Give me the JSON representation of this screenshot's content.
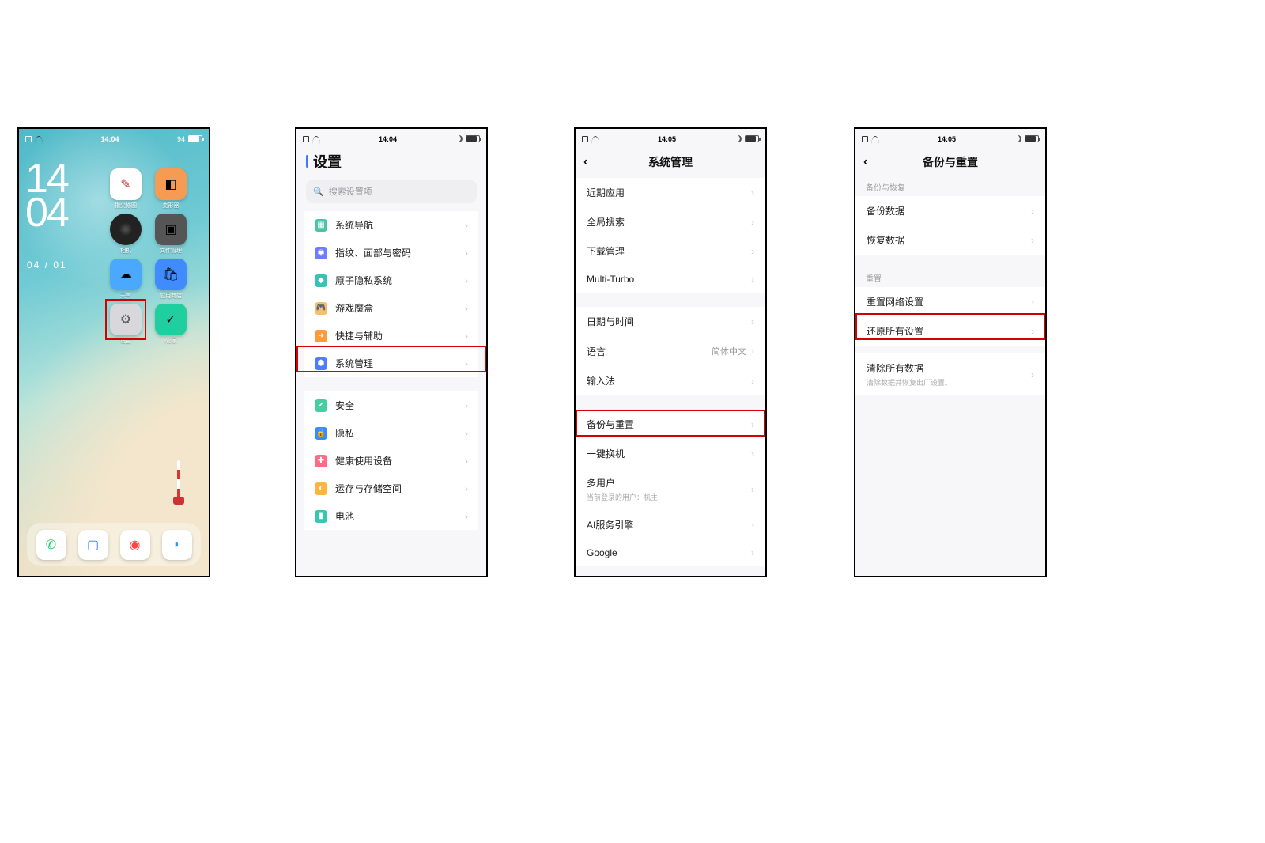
{
  "phone1": {
    "status": {
      "time": "14:04",
      "battery": "94"
    },
    "clock": {
      "hh": "14",
      "mm": "04"
    },
    "date": "04 / 01",
    "apps": {
      "a11": "指尖修图",
      "a12": "变形器",
      "a21": "相机",
      "a22": "文件管理",
      "a31": "天气",
      "a32": "应用商店",
      "a41": "设置",
      "a42": "i管家"
    }
  },
  "phone2": {
    "status": {
      "time": "14:04",
      "battery": "94"
    },
    "title": "设置",
    "search_placeholder": "搜索设置项",
    "items1": [
      "系统导航",
      "指纹、面部与密码",
      "原子隐私系统",
      "游戏魔盒",
      "快捷与辅助",
      "系统管理"
    ],
    "items2": [
      "安全",
      "隐私",
      "健康使用设备",
      "运存与存储空间",
      "电池"
    ]
  },
  "phone3": {
    "status": {
      "time": "14:05",
      "battery": "94"
    },
    "title": "系统管理",
    "grp1": [
      "近期应用",
      "全局搜索",
      "下载管理",
      "Multi-Turbo"
    ],
    "grp2": [
      {
        "label": "日期与时间"
      },
      {
        "label": "语言",
        "value": "简体中文"
      },
      {
        "label": "输入法"
      }
    ],
    "grp3": [
      {
        "label": "备份与重置"
      },
      {
        "label": "一键换机"
      },
      {
        "label": "多用户",
        "sub": "当前登录的用户：机主"
      },
      {
        "label": "AI服务引擎"
      },
      {
        "label": "Google"
      }
    ]
  },
  "phone4": {
    "status": {
      "time": "14:05",
      "battery": "94"
    },
    "title": "备份与重置",
    "sec1_hdr": "备份与恢复",
    "sec1": [
      "备份数据",
      "恢复数据"
    ],
    "sec2_hdr": "重置",
    "sec2a": [
      "重置网络设置",
      "还原所有设置"
    ],
    "sec2b_label": "清除所有数据",
    "sec2b_sub": "清除数据并恢复出厂设置。"
  }
}
